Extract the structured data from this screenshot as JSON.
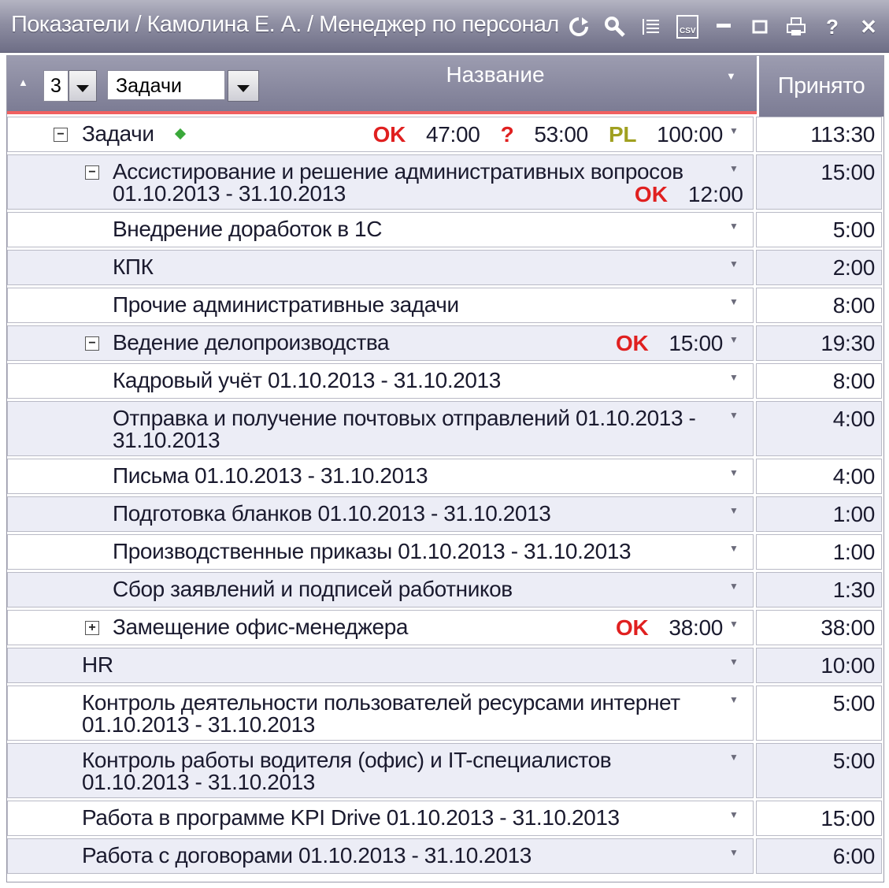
{
  "window": {
    "title": "Показатели / Камолина Е. А. / Менеджер по персонал",
    "icons": [
      "refresh-icon",
      "search-icon",
      "list-icon",
      "csv-icon",
      "minimize-icon",
      "maximize-icon",
      "print-icon",
      "help-icon",
      "close-icon"
    ],
    "csv_label": "CSV"
  },
  "header": {
    "level_value": "3",
    "type_value": "Задачи",
    "name_label": "Название",
    "accepted_label": "Принято"
  },
  "colors": {
    "ok": "#e02020",
    "pl": "#a0a020",
    "accent": "#f06060"
  },
  "rows": [
    {
      "label": "Задачи",
      "indent": 1,
      "toggle": "−",
      "acc": "113:30",
      "status": [
        {
          "k": "OK",
          "v": "47:00"
        },
        {
          "k": "?",
          "v": "53:00"
        },
        {
          "k": "PL",
          "v": "100:00"
        }
      ]
    },
    {
      "label": "Ассистирование и решение административных вопросов",
      "label2": "01.10.2013 - 31.10.2013",
      "indent": 2,
      "toggle": "−",
      "acc": "15:00",
      "status2": {
        "k": "OK",
        "v": "12:00"
      }
    },
    {
      "label": "Внедрение доработок в 1С",
      "indent": 3,
      "acc": "5:00"
    },
    {
      "label": "КПК",
      "indent": 3,
      "acc": "2:00"
    },
    {
      "label": "Прочие административные задачи",
      "indent": 3,
      "acc": "8:00"
    },
    {
      "label": "Ведение делопроизводства",
      "indent": 2,
      "toggle": "−",
      "acc": "19:30",
      "status": [
        {
          "k": "OK",
          "v": "15:00"
        }
      ]
    },
    {
      "label": "Кадровый учёт 01.10.2013 - 31.10.2013",
      "indent": 3,
      "acc": "8:00"
    },
    {
      "label": "Отправка и получение почтовых отправлений 01.10.2013 -",
      "label2": "31.10.2013",
      "indent": 3,
      "acc": "4:00"
    },
    {
      "label": "Письма 01.10.2013 - 31.10.2013",
      "indent": 3,
      "acc": "4:00"
    },
    {
      "label": "Подготовка бланков 01.10.2013 - 31.10.2013",
      "indent": 3,
      "acc": "1:00"
    },
    {
      "label": "Производственные приказы 01.10.2013 - 31.10.2013",
      "indent": 3,
      "acc": "1:00"
    },
    {
      "label": "Сбор заявлений и подписей работников",
      "indent": 3,
      "acc": "1:30"
    },
    {
      "label": "Замещение офис-менеджера",
      "indent": 2,
      "toggle": "+",
      "acc": "38:00",
      "status": [
        {
          "k": "OK",
          "v": "38:00"
        }
      ]
    },
    {
      "label": "HR",
      "indent": 1,
      "acc": "10:00"
    },
    {
      "label": "Контроль деятельности пользователей ресурсами интернет",
      "label2": "01.10.2013 - 31.10.2013",
      "indent": 1,
      "acc": "5:00"
    },
    {
      "label": "Контроль работы водителя (офис) и IT-специалистов",
      "label2": "01.10.2013 - 31.10.2013",
      "indent": 1,
      "acc": "5:00"
    },
    {
      "label": "Работа в программе KPI Drive 01.10.2013 - 31.10.2013",
      "indent": 1,
      "acc": "15:00"
    },
    {
      "label": "Работа с договорами 01.10.2013 - 31.10.2013",
      "indent": 1,
      "acc": "6:00"
    }
  ]
}
